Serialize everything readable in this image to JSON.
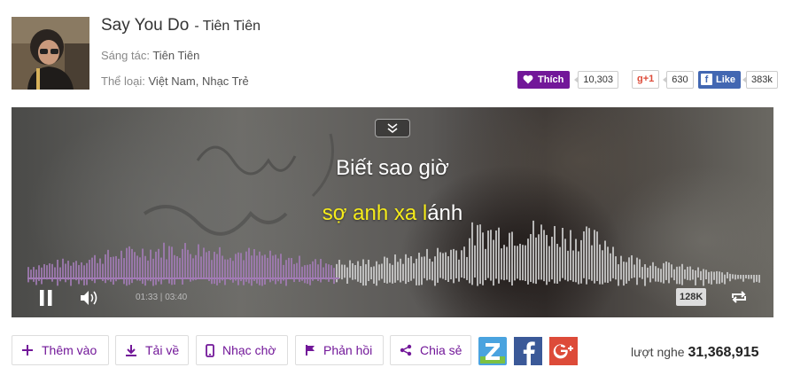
{
  "song": {
    "title": "Say You Do",
    "artist_separator": "- Tiên Tiên",
    "composer_label": "Sáng tác:",
    "composer": "Tiên Tiên",
    "genre_label": "Thể loại:",
    "genre": "Việt Nam, Nhạc Trẻ"
  },
  "social": {
    "like_label": "Thích",
    "like_count": "10,303",
    "gplus_label": "+1",
    "gplus_prefix": "g",
    "gplus_count": "630",
    "fb_label": "Like",
    "fb_count": "383k"
  },
  "player": {
    "lyric_line1": "Biết sao giờ",
    "lyric_line2_sung": "sợ anh xa l",
    "lyric_line2_rest": "ánh",
    "time_current": "01:33",
    "time_separator": " | ",
    "time_total": "03:40",
    "progress_fraction": 0.425,
    "quality": "128K",
    "icons": [
      "chevron-double-down-icon",
      "pause-icon",
      "volume-icon",
      "repeat-icon"
    ]
  },
  "toolbar": {
    "add_label": "Thêm vào",
    "download_label": "Tải về",
    "ringtone_label": "Nhạc chờ",
    "feedback_label": "Phản hồi",
    "share_label": "Chia sẻ"
  },
  "share_icons": [
    "zing-icon",
    "facebook-icon",
    "google-plus-icon"
  ],
  "stats": {
    "views_label": "lượt nghe",
    "views_count": "31,368,915"
  },
  "colors": {
    "accent": "#721799",
    "lyric_highlight": "#f6ec1a",
    "wave_played": "#a27bb5",
    "wave_unplayed": "#cfcfcf",
    "zing": "#4aa3df",
    "facebook": "#3b5998",
    "gplus": "#dd4b39"
  }
}
